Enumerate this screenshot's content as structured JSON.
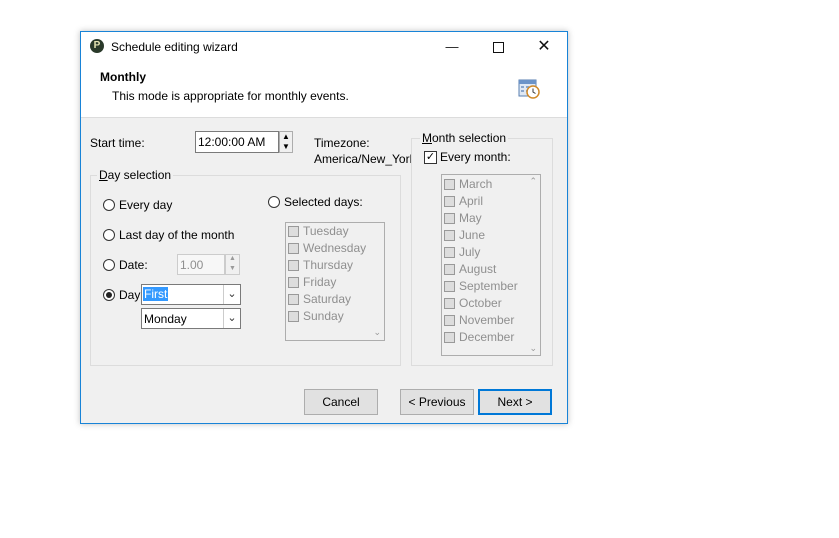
{
  "window": {
    "title": "Schedule editing wizard"
  },
  "header": {
    "title": "Monthly",
    "description": "This mode is appropriate for monthly events."
  },
  "start_time": {
    "label": "Start time:",
    "value": "12:00:00 AM"
  },
  "timezone": {
    "label": "Timezone:",
    "value": "America/New_York"
  },
  "day_selection": {
    "legend": "Day selection",
    "every_day": "Every day",
    "last_day": "Last day of the month",
    "date_label": "Date:",
    "date_value": "1.00",
    "day_label": "Day",
    "day_ordinal": "First",
    "weekday": "Monday",
    "selected_days_label": "Selected days:",
    "days": [
      "Tuesday",
      "Wednesday",
      "Thursday",
      "Friday",
      "Saturday",
      "Sunday"
    ]
  },
  "month_selection": {
    "legend": "Month selection",
    "every_month": "Every month:",
    "months": [
      "March",
      "April",
      "May",
      "June",
      "July",
      "August",
      "September",
      "October",
      "November",
      "December"
    ]
  },
  "buttons": {
    "cancel": "Cancel",
    "previous": "< Previous",
    "next": "Next >"
  },
  "icons": {
    "app": "app-icon",
    "minimize": "minimize-icon",
    "maximize": "maximize-icon",
    "close": "close-icon",
    "calendar": "calendar-clock-icon"
  },
  "colors": {
    "accent": "#0078d7",
    "selection": "#3399ff"
  }
}
